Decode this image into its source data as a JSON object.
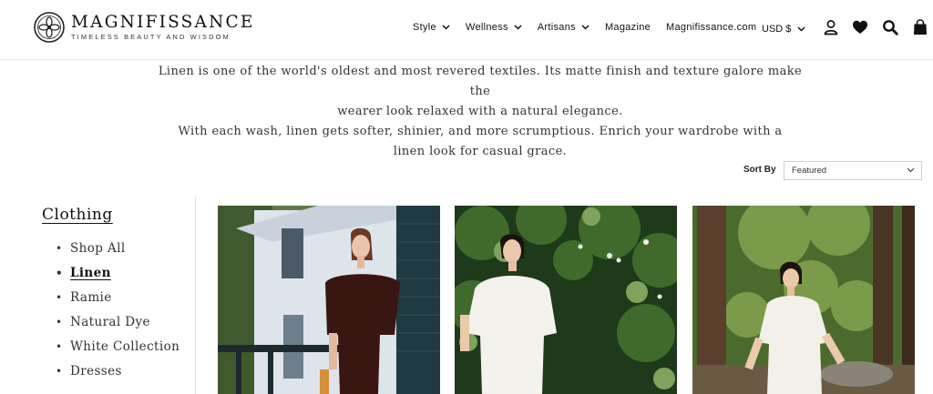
{
  "header": {
    "brand_name": "MAGNIFISSANCE",
    "brand_tagline": "TIMELESS BEAUTY AND WISDOM",
    "nav": [
      {
        "label": "Style",
        "has_dropdown": true
      },
      {
        "label": "Wellness",
        "has_dropdown": true
      },
      {
        "label": "Artisans",
        "has_dropdown": true
      },
      {
        "label": "Magazine",
        "has_dropdown": false
      },
      {
        "label": "Magnifissance.com",
        "has_dropdown": false
      }
    ],
    "currency": "USD $",
    "icons": [
      "account-icon",
      "heart-icon",
      "search-icon",
      "bag-icon"
    ]
  },
  "intro": {
    "line1": "Linen is one of the world's oldest and most revered textiles. Its matte finish and texture galore make the",
    "line2": "wearer look relaxed with a natural elegance.",
    "line3": "With each wash, linen gets softer, shinier, and more scrumptious. Enrich your wardrobe with a",
    "line4": "linen look for casual grace."
  },
  "sort": {
    "label": "Sort By",
    "selected": "Featured"
  },
  "sidebar": {
    "title": "Clothing",
    "items": [
      {
        "label": "Shop All",
        "active": false
      },
      {
        "label": "Linen",
        "active": true
      },
      {
        "label": "Ramie",
        "active": false
      },
      {
        "label": "Natural Dye",
        "active": false
      },
      {
        "label": "White Collection",
        "active": false
      },
      {
        "label": "Dresses",
        "active": false
      }
    ]
  },
  "products": [
    {
      "image": "woman-in-brown-linen-top-on-porch"
    },
    {
      "image": "woman-in-white-linen-top-in-garden"
    },
    {
      "image": "woman-in-white-linen-dress-in-forest"
    }
  ],
  "colors": {
    "text": "#111111",
    "body_text": "#333333",
    "border": "#e6e6e6"
  }
}
